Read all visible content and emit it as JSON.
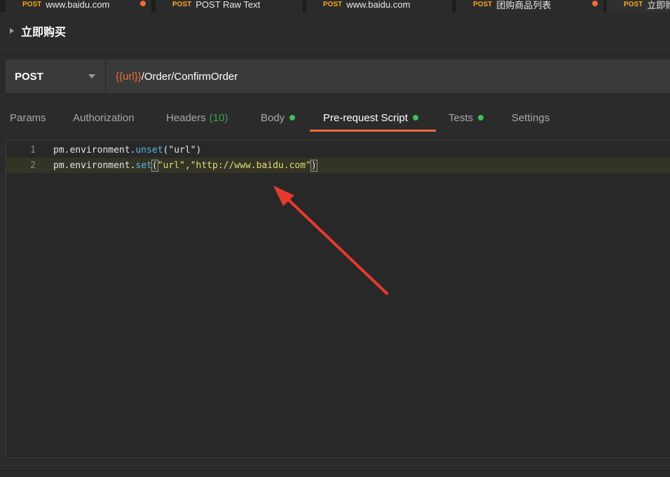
{
  "tabs": [
    {
      "method": "POST",
      "title": "www.baidu.com",
      "dot": true
    },
    {
      "method": "POST",
      "title": "POST Raw Text",
      "dot": false
    },
    {
      "method": "POST",
      "title": "www.baidu.com",
      "dot": false
    },
    {
      "method": "POST",
      "title": "团购商品列表",
      "dot": true
    },
    {
      "method": "POST",
      "title": "立即购",
      "dot": false
    }
  ],
  "request": {
    "name": "立即购买",
    "method": "POST",
    "url_var": "{{url}}",
    "url_path": "/Order/ConfirmOrder"
  },
  "subtabs": {
    "params": "Params",
    "authorization": "Authorization",
    "headers": "Headers",
    "headers_count": "(10)",
    "body": "Body",
    "prerequest": "Pre-request Script",
    "tests": "Tests",
    "settings": "Settings"
  },
  "editor": {
    "lines": [
      {
        "num": "1",
        "obj": "pm.environment.",
        "fn": "unset",
        "open": "(",
        "arg1": "\"url\"",
        "sep": "",
        "arg2": "",
        "close": ")"
      },
      {
        "num": "2",
        "obj": "pm.environment.",
        "fn": "set",
        "open": "(",
        "arg1": "\"url\"",
        "sep": ",",
        "arg2": "\"http://www.baidu.com\"",
        "close": ")"
      }
    ]
  },
  "colors": {
    "accent": "#f26b3a",
    "method_tag": "#f6a623",
    "green_dot": "#3fbf5a",
    "annotation_arrow": "#e8392f"
  }
}
